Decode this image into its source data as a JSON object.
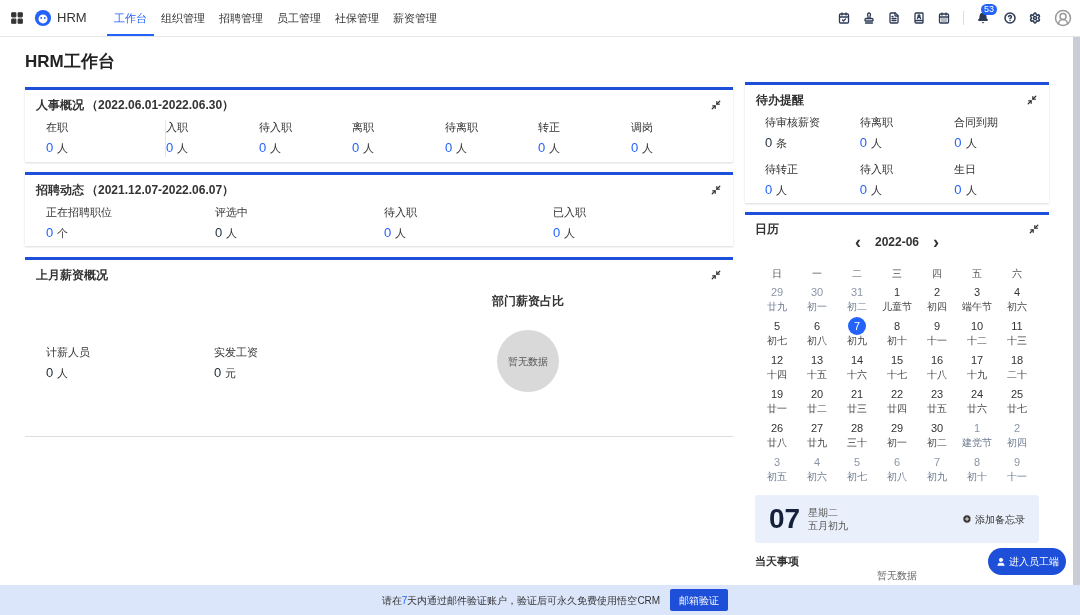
{
  "nav": {
    "brand": "HRM",
    "tabs": [
      {
        "label": "工作台",
        "selected": true
      },
      {
        "label": "组织管理",
        "selected": false
      },
      {
        "label": "招聘管理",
        "selected": false
      },
      {
        "label": "员工管理",
        "selected": false
      },
      {
        "label": "社保管理",
        "selected": false
      },
      {
        "label": "薪资管理",
        "selected": false
      }
    ],
    "notification_count": "53"
  },
  "page_title": "HRM工作台",
  "hr_overview": {
    "title": "人事概况",
    "period": "（2022.06.01-2022.06.30）",
    "stats": [
      {
        "label": "在职",
        "value": "0",
        "unit": "人",
        "kind": "link"
      },
      {
        "label": "入职",
        "value": "0",
        "unit": "人",
        "kind": "link"
      },
      {
        "label": "待入职",
        "value": "0",
        "unit": "人",
        "kind": "link"
      },
      {
        "label": "离职",
        "value": "0",
        "unit": "人",
        "kind": "link"
      },
      {
        "label": "待离职",
        "value": "0",
        "unit": "人",
        "kind": "link"
      },
      {
        "label": "转正",
        "value": "0",
        "unit": "人",
        "kind": "link"
      },
      {
        "label": "调岗",
        "value": "0",
        "unit": "人",
        "kind": "link"
      }
    ]
  },
  "recruitment": {
    "title": "招聘动态",
    "period": "（2021.12.07-2022.06.07）",
    "stats": [
      {
        "label": "正在招聘职位",
        "value": "0",
        "unit": "个",
        "kind": "link"
      },
      {
        "label": "评选中",
        "value": "0",
        "unit": "人",
        "kind": "plain"
      },
      {
        "label": "待入职",
        "value": "0",
        "unit": "人",
        "kind": "link"
      },
      {
        "label": "已入职",
        "value": "0",
        "unit": "人",
        "kind": "link"
      }
    ]
  },
  "salary": {
    "title": "上月薪资概况",
    "stats": [
      {
        "label": "计薪人员",
        "value": "0",
        "unit": "人",
        "kind": "plain"
      },
      {
        "label": "实发工资",
        "value": "0",
        "unit": "元",
        "kind": "plain"
      }
    ],
    "chart_title": "部门薪资占比",
    "empty_text": "暂无数据"
  },
  "todo": {
    "title": "待办提醒",
    "stats": [
      {
        "label": "待审核薪资",
        "value": "0",
        "unit": "条",
        "kind": "plain"
      },
      {
        "label": "待离职",
        "value": "0",
        "unit": "人",
        "kind": "link"
      },
      {
        "label": "合同到期",
        "value": "0",
        "unit": "人",
        "kind": "link"
      },
      {
        "label": "待转正",
        "value": "0",
        "unit": "人",
        "kind": "link"
      },
      {
        "label": "待入职",
        "value": "0",
        "unit": "人",
        "kind": "link"
      },
      {
        "label": "生日",
        "value": "0",
        "unit": "人",
        "kind": "link"
      }
    ]
  },
  "calendar": {
    "title": "日历",
    "prev": "‹",
    "month": "2022-06",
    "next": "›",
    "weekdays": [
      "日",
      "一",
      "二",
      "三",
      "四",
      "五",
      "六"
    ],
    "weeks": [
      [
        {
          "day": "29",
          "lunar": "廿九",
          "in_month": false,
          "selected": false
        },
        {
          "day": "30",
          "lunar": "初一",
          "in_month": false,
          "selected": false
        },
        {
          "day": "31",
          "lunar": "初二",
          "in_month": false,
          "selected": false
        },
        {
          "day": "1",
          "lunar": "儿童节",
          "in_month": true,
          "selected": false
        },
        {
          "day": "2",
          "lunar": "初四",
          "in_month": true,
          "selected": false
        },
        {
          "day": "3",
          "lunar": "端午节",
          "in_month": true,
          "selected": false
        },
        {
          "day": "4",
          "lunar": "初六",
          "in_month": true,
          "selected": false
        }
      ],
      [
        {
          "day": "5",
          "lunar": "初七",
          "in_month": true,
          "selected": false
        },
        {
          "day": "6",
          "lunar": "初八",
          "in_month": true,
          "selected": false
        },
        {
          "day": "7",
          "lunar": "初九",
          "in_month": true,
          "selected": true
        },
        {
          "day": "8",
          "lunar": "初十",
          "in_month": true,
          "selected": false
        },
        {
          "day": "9",
          "lunar": "十一",
          "in_month": true,
          "selected": false
        },
        {
          "day": "10",
          "lunar": "十二",
          "in_month": true,
          "selected": false
        },
        {
          "day": "11",
          "lunar": "十三",
          "in_month": true,
          "selected": false
        }
      ],
      [
        {
          "day": "12",
          "lunar": "十四",
          "in_month": true,
          "selected": false
        },
        {
          "day": "13",
          "lunar": "十五",
          "in_month": true,
          "selected": false
        },
        {
          "day": "14",
          "lunar": "十六",
          "in_month": true,
          "selected": false
        },
        {
          "day": "15",
          "lunar": "十七",
          "in_month": true,
          "selected": false
        },
        {
          "day": "16",
          "lunar": "十八",
          "in_month": true,
          "selected": false
        },
        {
          "day": "17",
          "lunar": "十九",
          "in_month": true,
          "selected": false
        },
        {
          "day": "18",
          "lunar": "二十",
          "in_month": true,
          "selected": false
        }
      ],
      [
        {
          "day": "19",
          "lunar": "廿一",
          "in_month": true,
          "selected": false
        },
        {
          "day": "20",
          "lunar": "廿二",
          "in_month": true,
          "selected": false
        },
        {
          "day": "21",
          "lunar": "廿三",
          "in_month": true,
          "selected": false
        },
        {
          "day": "22",
          "lunar": "廿四",
          "in_month": true,
          "selected": false
        },
        {
          "day": "23",
          "lunar": "廿五",
          "in_month": true,
          "selected": false
        },
        {
          "day": "24",
          "lunar": "廿六",
          "in_month": true,
          "selected": false
        },
        {
          "day": "25",
          "lunar": "廿七",
          "in_month": true,
          "selected": false
        }
      ],
      [
        {
          "day": "26",
          "lunar": "廿八",
          "in_month": true,
          "selected": false
        },
        {
          "day": "27",
          "lunar": "廿九",
          "in_month": true,
          "selected": false
        },
        {
          "day": "28",
          "lunar": "三十",
          "in_month": true,
          "selected": false
        },
        {
          "day": "29",
          "lunar": "初一",
          "in_month": true,
          "selected": false
        },
        {
          "day": "30",
          "lunar": "初二",
          "in_month": true,
          "selected": false
        },
        {
          "day": "1",
          "lunar": "建党节",
          "in_month": false,
          "selected": false
        },
        {
          "day": "2",
          "lunar": "初四",
          "in_month": false,
          "selected": false
        }
      ],
      [
        {
          "day": "3",
          "lunar": "初五",
          "in_month": false,
          "selected": false
        },
        {
          "day": "4",
          "lunar": "初六",
          "in_month": false,
          "selected": false
        },
        {
          "day": "5",
          "lunar": "初七",
          "in_month": false,
          "selected": false
        },
        {
          "day": "6",
          "lunar": "初八",
          "in_month": false,
          "selected": false
        },
        {
          "day": "7",
          "lunar": "初九",
          "in_month": false,
          "selected": false
        },
        {
          "day": "8",
          "lunar": "初十",
          "in_month": false,
          "selected": false
        },
        {
          "day": "9",
          "lunar": "十一",
          "in_month": false,
          "selected": false
        }
      ]
    ],
    "today": {
      "day": "07",
      "weekday": "星期二",
      "lunar": "五月初九",
      "add_memo": "添加备忘录"
    },
    "events_title": "当天事项",
    "events_empty": "暂无数据"
  },
  "employee_portal_button": "进入员工端",
  "notice": {
    "before": "请在",
    "highlight": "7",
    "after": "天内通过邮件验证账户，验证后可永久免费使用悟空CRM",
    "button": "邮箱验证"
  }
}
